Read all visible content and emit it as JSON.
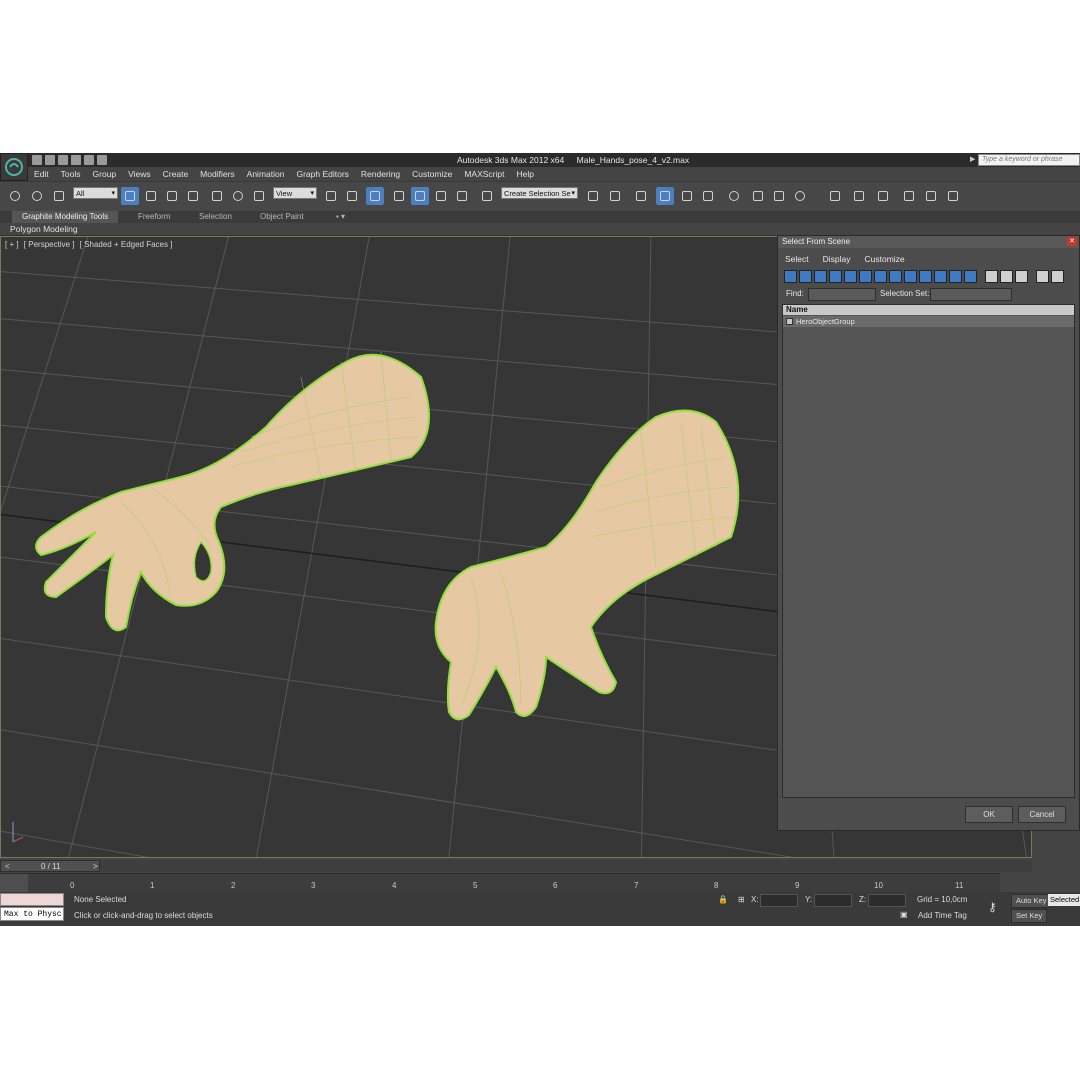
{
  "app": {
    "title": "Autodesk 3ds Max  2012 x64",
    "file": "Male_Hands_pose_4_v2.max",
    "search_placeholder": "Type a keyword or phrase"
  },
  "menubar": [
    "Edit",
    "Tools",
    "Group",
    "Views",
    "Create",
    "Modifiers",
    "Animation",
    "Graph Editors",
    "Rendering",
    "Customize",
    "MAXScript",
    "Help"
  ],
  "toolbar": {
    "filter_value": "All",
    "coord_value": "View",
    "selection_set_value": "Create Selection Se"
  },
  "ribbon": {
    "tabs": [
      "Graphite Modeling Tools",
      "Freeform",
      "Selection",
      "Object Paint"
    ],
    "sub_label": "Polygon Modeling"
  },
  "viewport": {
    "label_plus": "[ + ]",
    "label_view": "[ Perspective ]",
    "label_shading": "[ Shaded + Edged Faces ]"
  },
  "timeslider": {
    "left": "<",
    "frame": "0 / 11",
    "right": ">"
  },
  "ruler_ticks": [
    "0",
    "1",
    "2",
    "3",
    "4",
    "5",
    "6",
    "7",
    "8",
    "9",
    "10",
    "11"
  ],
  "status": {
    "maxscript": "Max to Physc",
    "selection": "None Selected",
    "prompt": "Click or click-and-drag to select objects",
    "x_label": "X:",
    "y_label": "Y:",
    "z_label": "Z:",
    "grid": "Grid = 10,0cm",
    "add_time_tag": "Add Time Tag",
    "auto_key": "Auto Key",
    "set_key": "Set Key",
    "selected": "Selected"
  },
  "dialog": {
    "title": "Select From Scene",
    "menu": [
      "Select",
      "Display",
      "Customize"
    ],
    "find_label": "Find:",
    "selection_set_label": "Selection Set:",
    "column_name": "Name",
    "items": [
      "HeroObjectGroup"
    ],
    "ok": "OK",
    "cancel": "Cancel"
  }
}
